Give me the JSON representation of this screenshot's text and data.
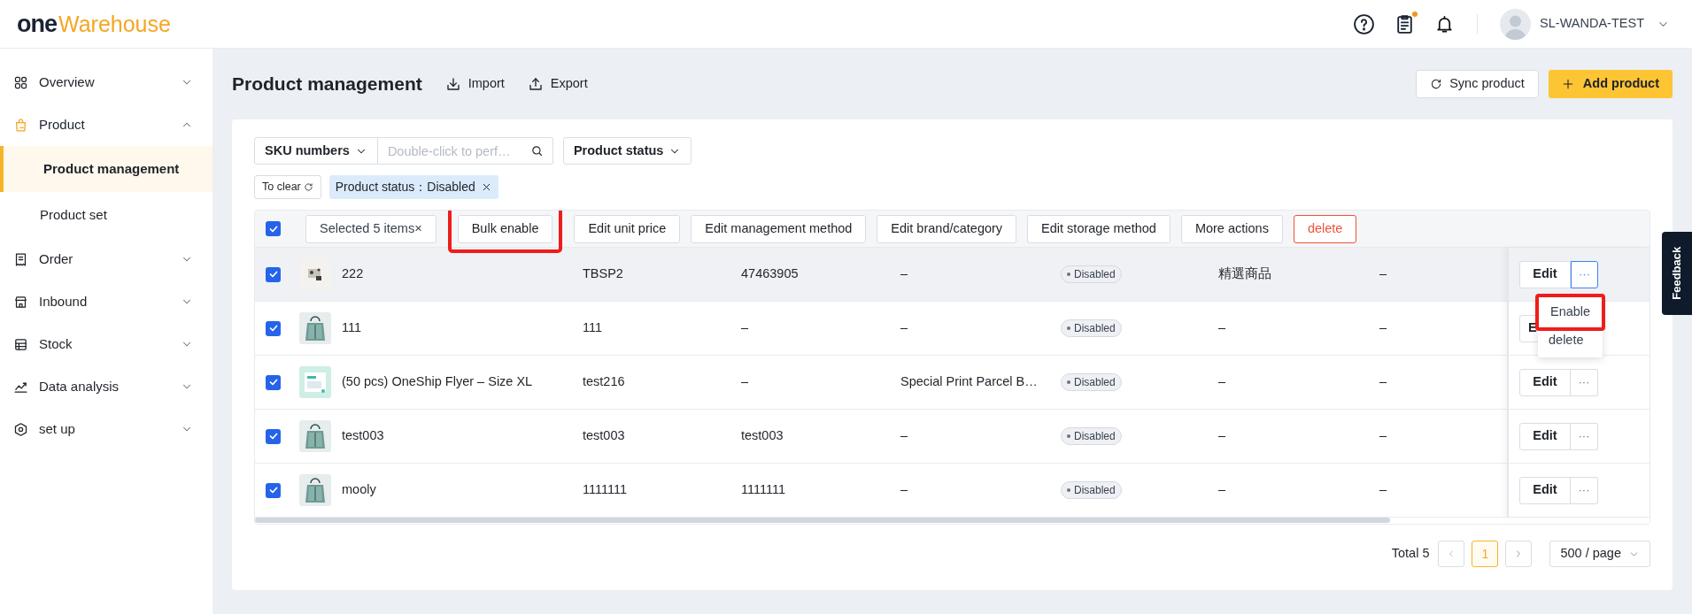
{
  "header": {
    "logo_mark": "one",
    "logo_text": "Warehouse",
    "tasks_notification": true,
    "user_name": "SL-WANDA-TEST"
  },
  "sidebar": {
    "items": [
      {
        "label": "Overview",
        "expanded": false,
        "selected": false
      },
      {
        "label": "Product",
        "expanded": true,
        "selected": true,
        "children": [
          {
            "label": "Product management",
            "selected": true
          },
          {
            "label": "Product set",
            "selected": false
          }
        ]
      },
      {
        "label": "Order",
        "expanded": false,
        "selected": false
      },
      {
        "label": "Inbound",
        "expanded": false,
        "selected": false
      },
      {
        "label": "Stock",
        "expanded": false,
        "selected": false
      },
      {
        "label": "Data analysis",
        "expanded": false,
        "selected": false
      },
      {
        "label": "set up",
        "expanded": false,
        "selected": false
      }
    ]
  },
  "page": {
    "title": "Product management",
    "import": "Import",
    "export": "Export",
    "sync_button": "Sync product",
    "add_button": "Add product"
  },
  "filters": {
    "field_select": "SKU numbers",
    "search_placeholder": "Double-click to perf…",
    "status_select": "Product status",
    "clear": "To clear",
    "tags": [
      {
        "label": "Product status：Disabled"
      }
    ]
  },
  "bulk_bar": {
    "all_checked": true,
    "actions": [
      {
        "label": "Selected 5 items×",
        "kind": "selection",
        "highlighted": false
      },
      {
        "label": "Bulk enable",
        "kind": "normal",
        "highlighted": true
      },
      {
        "label": "Edit unit price",
        "kind": "normal",
        "highlighted": false
      },
      {
        "label": "Edit management method",
        "kind": "normal",
        "highlighted": false
      },
      {
        "label": "Edit brand/category",
        "kind": "normal",
        "highlighted": false
      },
      {
        "label": "Edit storage method",
        "kind": "normal",
        "highlighted": false
      },
      {
        "label": "More actions",
        "kind": "normal",
        "highlighted": false
      },
      {
        "label": "delete",
        "kind": "danger",
        "highlighted": false
      }
    ]
  },
  "table": {
    "rows": [
      {
        "selected": true,
        "hovered": true,
        "name": "222",
        "sku": "TBSP2",
        "column_3": "47463905",
        "column_4": "–",
        "status": "Disabled",
        "column_6": "精選商品",
        "column_7": "–",
        "edit": "Edit",
        "more": "···",
        "menu": [
          {
            "label": "Enable",
            "highlighted": true
          },
          {
            "label": "delete",
            "highlighted": false
          }
        ]
      },
      {
        "selected": true,
        "hovered": false,
        "name": "111",
        "sku": "111",
        "column_3": "–",
        "column_4": "–",
        "status": "Disabled",
        "column_6": "–",
        "column_7": "–",
        "edit": "E"
      },
      {
        "selected": true,
        "hovered": false,
        "name": "(50 pcs) OneShip Flyer – Size XL",
        "sku": "test216",
        "column_3": "–",
        "column_4": "Special Print Parcel B…",
        "status": "Disabled",
        "column_6": "–",
        "column_7": "–",
        "edit": "Edit",
        "more": "···"
      },
      {
        "selected": true,
        "hovered": false,
        "name": "test003",
        "sku": "test003",
        "column_3": "test003",
        "column_4": "–",
        "status": "Disabled",
        "column_6": "–",
        "column_7": "–",
        "edit": "Edit",
        "more": "···"
      },
      {
        "selected": true,
        "hovered": false,
        "name": "mooly",
        "sku": "1111111",
        "column_3": "1111111",
        "column_4": "–",
        "status": "Disabled",
        "column_6": "–",
        "column_7": "–",
        "edit": "Edit",
        "more": "···"
      }
    ]
  },
  "pagination": {
    "total": "Total 5",
    "pages": [
      {
        "label": "1",
        "selected": true
      }
    ],
    "page_size": "500 / page"
  },
  "feedback_tab": "Feedback"
}
